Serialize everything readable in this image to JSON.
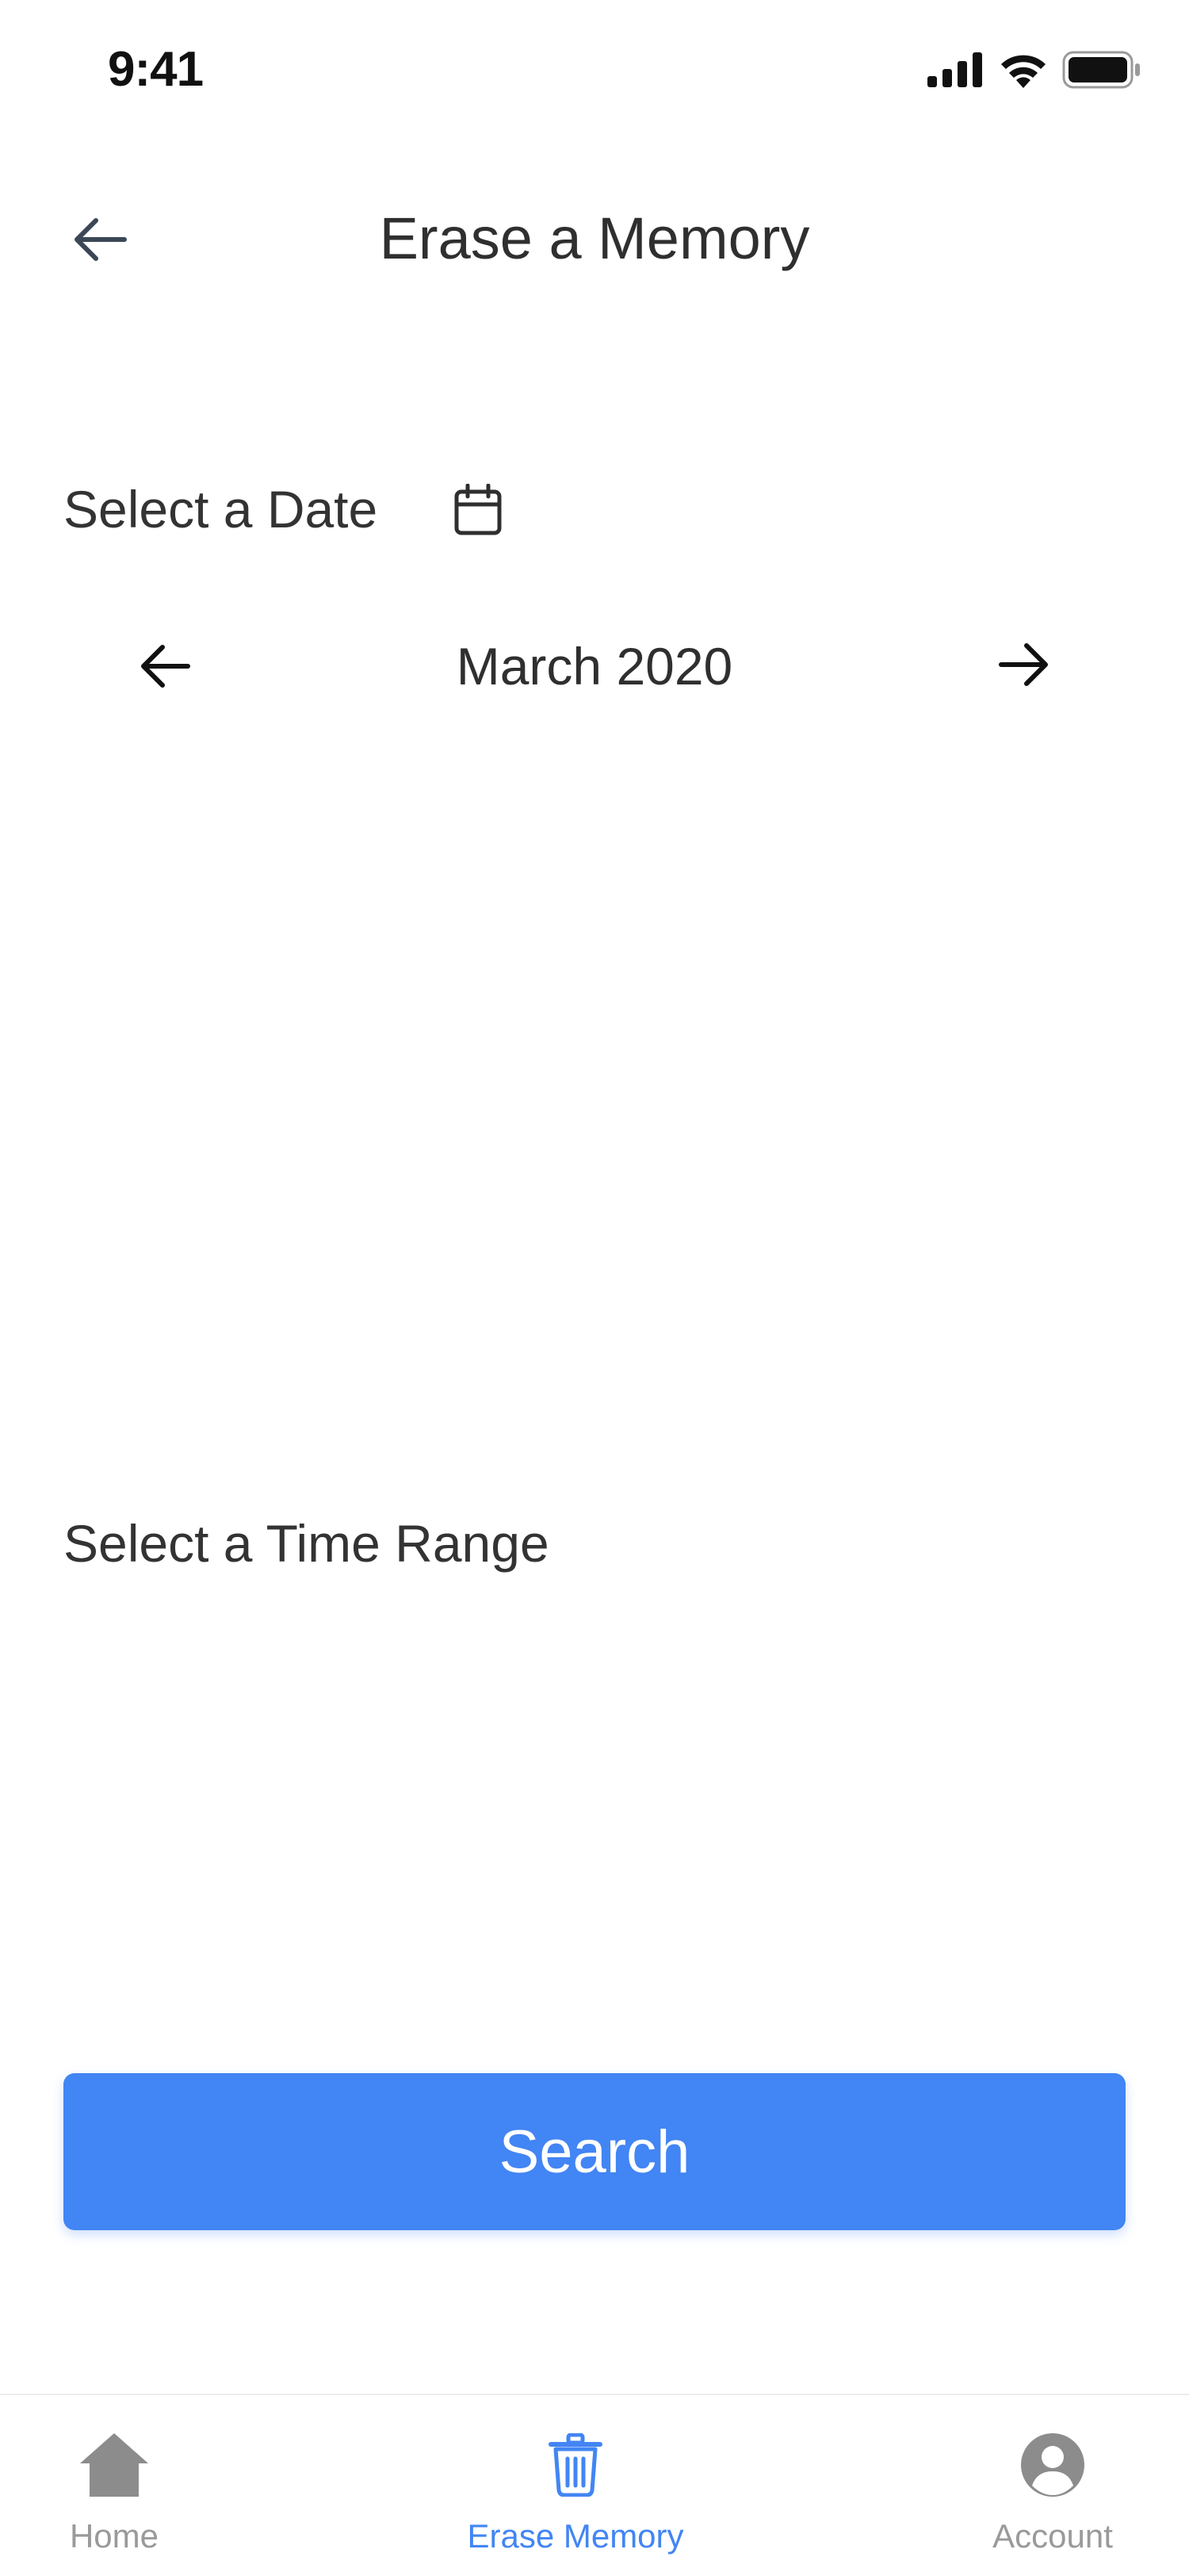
{
  "status_bar": {
    "time": "9:41",
    "icons": [
      "cellular-signal-icon",
      "wifi-icon",
      "battery-icon"
    ]
  },
  "header": {
    "title": "Erase a Memory",
    "back_icon": "arrow-left-icon"
  },
  "date_section": {
    "label": "Select a Date",
    "calendar_icon": "calendar-icon",
    "month_label": "March 2020",
    "prev_icon": "arrow-left-icon",
    "next_icon": "arrow-right-icon"
  },
  "time_section": {
    "label": "Select a Time Range"
  },
  "search_button": {
    "label": "Search"
  },
  "tab_bar": {
    "active": "Erase Memory",
    "tabs": [
      {
        "label": "Home",
        "icon": "home-icon"
      },
      {
        "label": "Erase Memory",
        "icon": "trash-icon"
      },
      {
        "label": "Account",
        "icon": "account-icon"
      }
    ]
  },
  "colors": {
    "accent": "#4285f4",
    "text": "#2f2f2f",
    "inactive_tab": "#9a9a9a"
  }
}
